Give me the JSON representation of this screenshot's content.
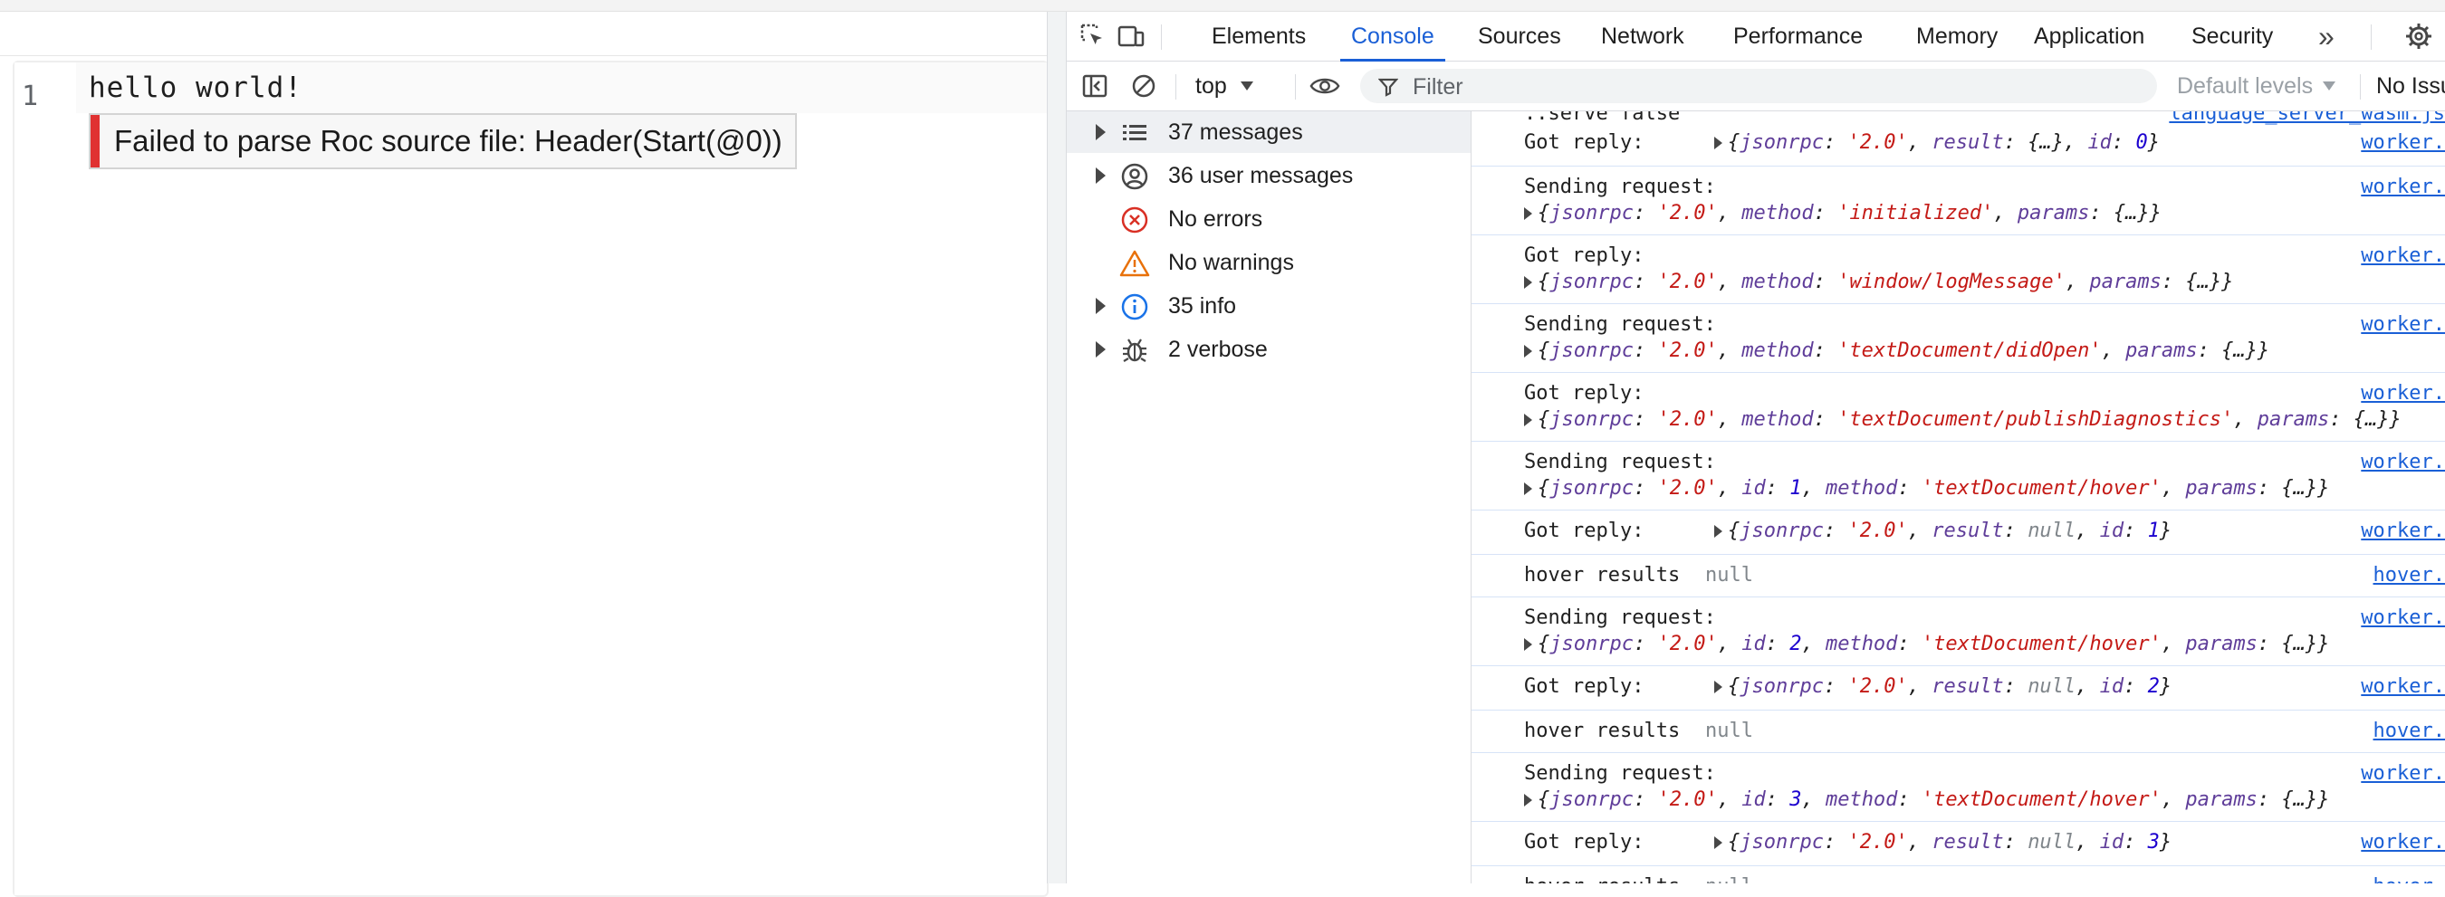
{
  "editor": {
    "line_number": "1",
    "code": "hello world!",
    "diagnostic": "Failed to parse Roc source file: Header(Start(@0))"
  },
  "devtools": {
    "tabs": [
      {
        "label": "Elements"
      },
      {
        "label": "Console",
        "active": true
      },
      {
        "label": "Sources"
      },
      {
        "label": "Network"
      },
      {
        "label": "Performance"
      },
      {
        "label": "Memory"
      },
      {
        "label": "Application"
      },
      {
        "label": "Security"
      }
    ],
    "more_tabs": "»",
    "toolbar": {
      "context": "top",
      "filter_placeholder": "Filter",
      "levels": "Default levels",
      "issues": "No Issues"
    },
    "sidebar": [
      {
        "label": "37 messages",
        "icon": "list-icon"
      },
      {
        "label": "36 user messages",
        "icon": "user-icon"
      },
      {
        "label": "No errors",
        "icon": "error-icon"
      },
      {
        "label": "No warnings",
        "icon": "warning-icon"
      },
      {
        "label": "35 info",
        "icon": "info-icon"
      },
      {
        "label": "2 verbose",
        "icon": "bug-icon"
      }
    ],
    "log": {
      "top_partial": "..serve false",
      "top_partial_link": "language_server_wasm.js",
      "rows": [
        {
          "kind": "reply",
          "text": "Got reply:",
          "obj": {
            "jsonrpc": "'2.0'",
            "result": "{…}",
            "id": "0"
          },
          "link": "worker."
        },
        {
          "kind": "send",
          "text": "Sending request:",
          "obj": {
            "jsonrpc": "'2.0'",
            "method": "'initialized'",
            "params": "{…}"
          },
          "link": "worker."
        },
        {
          "kind": "send",
          "text": "Got reply:",
          "obj": {
            "jsonrpc": "'2.0'",
            "method": "'window/logMessage'",
            "params": "{…}"
          },
          "link": "worker."
        },
        {
          "kind": "send",
          "text": "Sending request:",
          "obj": {
            "jsonrpc": "'2.0'",
            "method": "'textDocument/didOpen'",
            "params": "{…}"
          },
          "link": "worker."
        },
        {
          "kind": "send",
          "text": "Got reply:",
          "obj": {
            "jsonrpc": "'2.0'",
            "method": "'textDocument/publishDiagnostics'",
            "params": "{…}"
          },
          "link": "worker."
        },
        {
          "kind": "send",
          "text": "Sending request:",
          "obj": {
            "jsonrpc": "'2.0'",
            "id": "1",
            "method": "'textDocument/hover'",
            "params": "{…}"
          },
          "link": "worker."
        },
        {
          "kind": "reply",
          "text": "Got reply:",
          "obj": {
            "jsonrpc": "'2.0'",
            "result": "null",
            "id": "1"
          },
          "link": "worker."
        },
        {
          "kind": "hover",
          "text": "hover results",
          "value": "null",
          "link": "hover."
        },
        {
          "kind": "send",
          "text": "Sending request:",
          "obj": {
            "jsonrpc": "'2.0'",
            "id": "2",
            "method": "'textDocument/hover'",
            "params": "{…}"
          },
          "link": "worker."
        },
        {
          "kind": "reply",
          "text": "Got reply:",
          "obj": {
            "jsonrpc": "'2.0'",
            "result": "null",
            "id": "2"
          },
          "link": "worker."
        },
        {
          "kind": "hover",
          "text": "hover results",
          "value": "null",
          "link": "hover."
        },
        {
          "kind": "send",
          "text": "Sending request:",
          "obj": {
            "jsonrpc": "'2.0'",
            "id": "3",
            "method": "'textDocument/hover'",
            "params": "{…}"
          },
          "link": "worker."
        },
        {
          "kind": "reply",
          "text": "Got reply:",
          "obj": {
            "jsonrpc": "'2.0'",
            "result": "null",
            "id": "3"
          },
          "link": "worker."
        },
        {
          "kind": "hover",
          "text": "hover results",
          "value": "null",
          "link": "hover."
        }
      ]
    }
  }
}
